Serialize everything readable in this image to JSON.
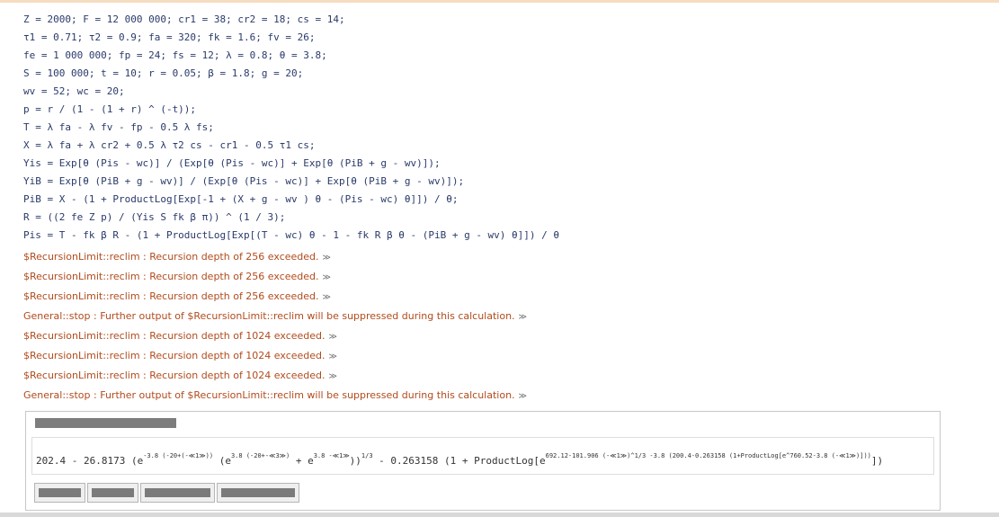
{
  "notebook": {
    "input_lines": [
      "Z = 2000; F = 12 000 000; cr1 = 38; cr2 = 18; cs = 14;",
      "τ1 = 0.71; τ2 = 0.9; fa = 320; fk = 1.6; fv = 26;",
      "fe = 1 000 000; fp = 24; fs = 12; λ = 0.8; θ = 3.8;",
      "S = 100 000; t = 10; r = 0.05; β = 1.8; g = 20;",
      "wv = 52; wc = 20;",
      "p = r / (1 - (1 + r) ^ (-t));",
      "T = λ fa - λ fv - fp - 0.5 λ fs;",
      "X = λ fa + λ cr2 + 0.5 λ τ2 cs - cr1 - 0.5 τ1 cs;",
      "Yis = Exp[θ (Pis - wc)] / (Exp[θ (Pis - wc)] + Exp[θ (PiB + g - wv)]);",
      "YiB = Exp[θ (PiB + g - wv)] / (Exp[θ (Pis - wc)] + Exp[θ (PiB + g - wv)]);",
      "PiB = X - (1 + ProductLog[Exp[-1 + (X + g - wv ) θ - (Pis - wc) θ]]) / θ;",
      "R = ((2 fe Z p) / (Yis S fk β π)) ^ (1 / 3);",
      "Pis = T - fk β R - (1 + ProductLog[Exp[(T - wc) θ - 1 - fk R β θ - (PiB + g - wv) θ]]) / θ"
    ],
    "messages": [
      "$RecursionLimit::reclim : Recursion depth of 256 exceeded.",
      "$RecursionLimit::reclim : Recursion depth of 256 exceeded.",
      "$RecursionLimit::reclim : Recursion depth of 256 exceeded.",
      "General::stop : Further output of $RecursionLimit::reclim will be suppressed during this calculation.",
      "$RecursionLimit::reclim : Recursion depth of 1024 exceeded.",
      "$RecursionLimit::reclim : Recursion depth of 1024 exceeded.",
      "$RecursionLimit::reclim : Recursion depth of 1024 exceeded.",
      "General::stop : Further output of $RecursionLimit::reclim will be suppressed during this calculation."
    ],
    "message_more_glyph": "≫",
    "output": {
      "p1": "202.4 - 26.8173 (e",
      "s1": "-3.8 (-20+(-≪1≫))",
      "p2": " (e",
      "s2": "3.8 (-20+-≪3≫)",
      "p3": " + e",
      "s3": "3.8 -≪1≫",
      "p4": "))",
      "s4": "1/3",
      "p5": " - 0.263158 (1 + ProductLog[e",
      "s5": "692.12-101.906 (-≪1≫)^1/3 -3.8 (200.4-0.263158 (1+ProductLog[e^760.52-3.8 (-≪1≫)]))",
      "p6": "])"
    }
  },
  "colors": {
    "code": "#2a3a6a",
    "message": "#b14b1c",
    "output_header": "#7d7d7d"
  }
}
